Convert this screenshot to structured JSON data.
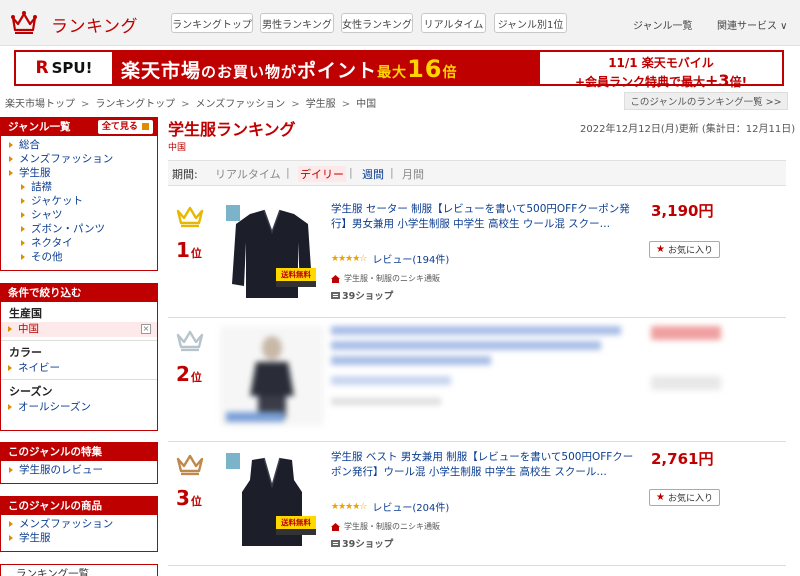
{
  "header": {
    "logo_text": "ランキング",
    "nav_buttons": [
      "ランキングトップ",
      "男性ランキング",
      "女性ランキング",
      "リアルタイム",
      "ジャンル別1位"
    ],
    "genre_list_link": "ジャンル一覧",
    "related_services": "関連サービス ∨"
  },
  "banner": {
    "spu_r": "R",
    "spu_text": "SPU!",
    "main_prefix": "楽天市場",
    "main_mid1": "のお買い物",
    "main_mid2": "が",
    "main_point": "ポイント",
    "main_max": "最大",
    "main_num": "16",
    "main_suffix": "倍",
    "right_line1": "11/1 楽天モバイル",
    "right_line2_prefix": "+会員ランク特典で最大",
    "right_line2_num": "+3",
    "right_line2_suffix": "倍!"
  },
  "breadcrumb": {
    "items": [
      "楽天市場トップ",
      "ランキングトップ",
      "メンズファッション",
      "学生服",
      "中国"
    ],
    "separator": ">",
    "right_link": "このジャンルのランキング一覧 >>"
  },
  "sidebar": {
    "genre_box": {
      "title": "ジャンル一覧",
      "see_all": "全て見る",
      "items": [
        {
          "label": "総合",
          "level": 0
        },
        {
          "label": "メンズファッション",
          "level": 0
        },
        {
          "label": "学生服",
          "level": 0
        },
        {
          "label": "詰襟",
          "level": 1
        },
        {
          "label": "ジャケット",
          "level": 1
        },
        {
          "label": "シャツ",
          "level": 1
        },
        {
          "label": "ズボン・パンツ",
          "level": 1
        },
        {
          "label": "ネクタイ",
          "level": 1
        },
        {
          "label": "その他",
          "level": 1
        }
      ]
    },
    "filter_box": {
      "title": "条件で絞り込む",
      "groups": [
        {
          "title": "生産国",
          "item": "中国",
          "selected": true
        },
        {
          "title": "カラー",
          "item": "ネイビー",
          "selected": false
        },
        {
          "title": "シーズン",
          "item": "オールシーズン",
          "selected": false
        }
      ],
      "clear_icon": "×"
    },
    "feature_box": {
      "title": "このジャンルの特集",
      "items": [
        "学生服のレビュー"
      ]
    },
    "products_box": {
      "title": "このジャンルの商品",
      "items": [
        "メンズファッション",
        "学生服"
      ]
    },
    "ranking_list_box": {
      "title": "ランキング一覧"
    }
  },
  "main": {
    "title": "学生服ランキング",
    "subtitle": "中国",
    "updated": "2022年12月12日(月)更新 (集計日：12月11日)",
    "period": {
      "label": "期間:",
      "options": [
        "リアルタイム",
        "デイリー",
        "週間",
        "月間"
      ],
      "active": "デイリー",
      "sep": "|"
    },
    "rows": [
      {
        "rank": "1",
        "rank_suffix": "位",
        "crown_color": "#e6b800",
        "title": "学生服 セーター 制服【レビューを書いて500円OFFクーポン発行】男女兼用 小学生制服 中学生 高校生 ウール混 スクー…",
        "price": "3,190円",
        "stars": "★★★★☆",
        "review": "レビュー(194件)",
        "shop": "学生服・制服のニシキ通販",
        "points": "39ショップ",
        "free_ship": "送料無料",
        "fav": "お気に入り",
        "product_kind": "sweater"
      },
      {
        "rank": "2",
        "rank_suffix": "位",
        "crown_color": "#b8c4cc",
        "title": "",
        "price": "",
        "stars": "",
        "review": "",
        "shop": "",
        "points": "",
        "free_ship": "",
        "fav": "",
        "product_kind": "blurred"
      },
      {
        "rank": "3",
        "rank_suffix": "位",
        "crown_color": "#c0884a",
        "title": "学生服 ベスト 男女兼用 制服【レビューを書いて500円OFFクーポン発行】ウール混 小学生制服 中学生 高校生 スクール…",
        "price": "2,761円",
        "stars": "★★★★☆",
        "review": "レビュー(204件)",
        "shop": "学生服・制服のニシキ通販",
        "points": "39ショップ",
        "free_ship": "送料無料",
        "fav": "お気に入り",
        "product_kind": "vest"
      }
    ]
  },
  "colors": {
    "brand_red": "#bf0000",
    "link_blue": "#0b3d91",
    "bullet_orange": "#e08c00"
  }
}
